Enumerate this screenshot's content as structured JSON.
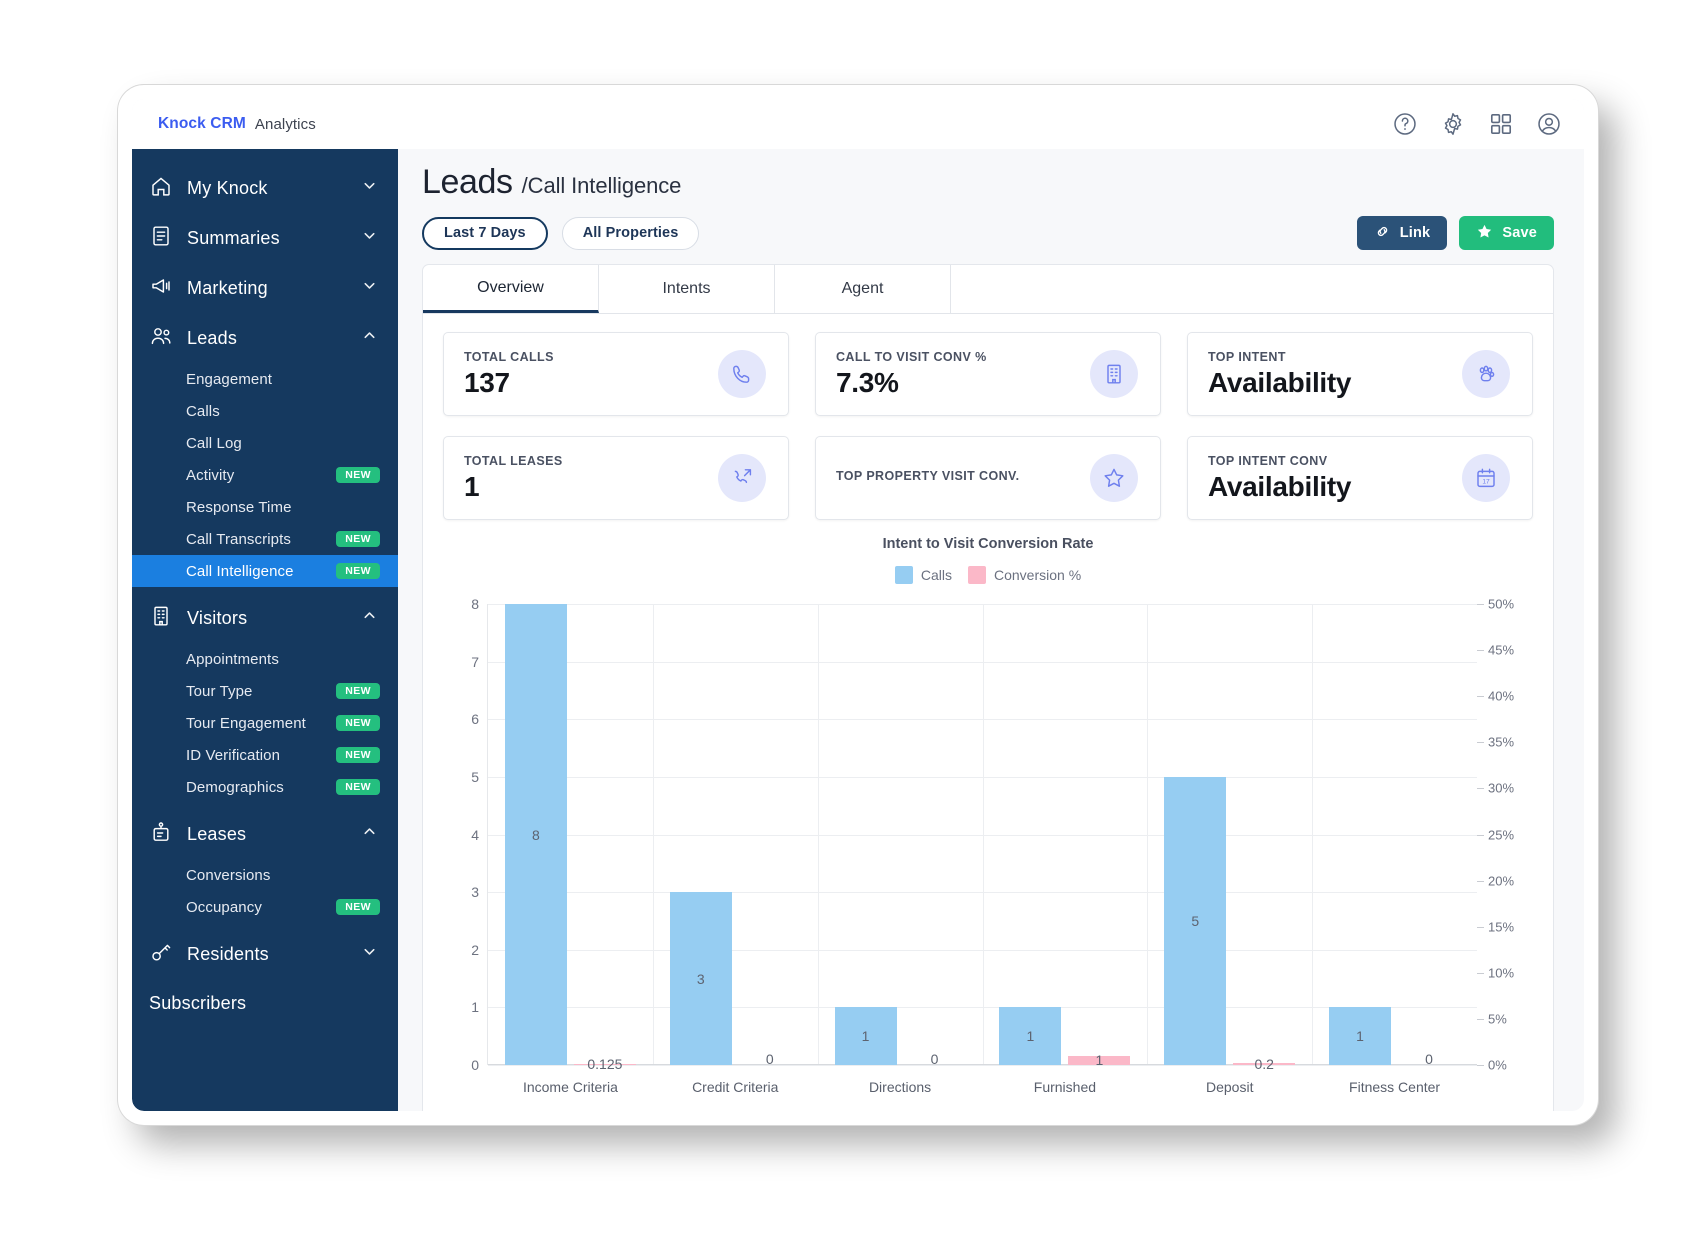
{
  "topbar": {
    "brand": "Knock CRM",
    "brand_sub": "Analytics",
    "icons": [
      "help-icon",
      "gear-icon",
      "grid-icon",
      "account-icon"
    ]
  },
  "sidebar": {
    "groups": [
      {
        "label": "My Knock",
        "icon": "home-icon",
        "expanded": false,
        "items": []
      },
      {
        "label": "Summaries",
        "icon": "document-icon",
        "expanded": false,
        "items": []
      },
      {
        "label": "Marketing",
        "icon": "megaphone-icon",
        "expanded": false,
        "items": []
      },
      {
        "label": "Leads",
        "icon": "people-icon",
        "expanded": true,
        "items": [
          {
            "label": "Engagement",
            "badge": "",
            "active": false
          },
          {
            "label": "Calls",
            "badge": "",
            "active": false
          },
          {
            "label": "Call Log",
            "badge": "",
            "active": false
          },
          {
            "label": "Activity",
            "badge": "NEW",
            "active": false
          },
          {
            "label": "Response Time",
            "badge": "",
            "active": false
          },
          {
            "label": "Call Transcripts",
            "badge": "NEW",
            "active": false
          },
          {
            "label": "Call Intelligence",
            "badge": "NEW",
            "active": true
          }
        ]
      },
      {
        "label": "Visitors",
        "icon": "building-icon",
        "expanded": true,
        "items": [
          {
            "label": "Appointments",
            "badge": "",
            "active": false
          },
          {
            "label": "Tour Type",
            "badge": "NEW",
            "active": false
          },
          {
            "label": "Tour Engagement",
            "badge": "NEW",
            "active": false
          },
          {
            "label": "ID Verification",
            "badge": "NEW",
            "active": false
          },
          {
            "label": "Demographics",
            "badge": "NEW",
            "active": false
          }
        ]
      },
      {
        "label": "Leases",
        "icon": "lease-icon",
        "expanded": true,
        "items": [
          {
            "label": "Conversions",
            "badge": "",
            "active": false
          },
          {
            "label": "Occupancy",
            "badge": "NEW",
            "active": false
          }
        ]
      },
      {
        "label": "Residents",
        "icon": "key-icon",
        "expanded": false,
        "items": []
      }
    ],
    "plain_item": "Subscribers"
  },
  "page": {
    "title": "Leads",
    "subtitle": "/Call Intelligence",
    "filters": [
      {
        "label": "Last 7 Days",
        "selected": true
      },
      {
        "label": "All Properties",
        "selected": false
      }
    ],
    "actions": [
      {
        "label": "Link",
        "icon": "link-icon",
        "style": "dark"
      },
      {
        "label": "Save",
        "icon": "star-icon",
        "style": "green"
      }
    ]
  },
  "tabs": [
    {
      "label": "Overview",
      "active": true
    },
    {
      "label": "Intents",
      "active": false
    },
    {
      "label": "Agent",
      "active": false
    }
  ],
  "kpis": [
    [
      {
        "label": "TOTAL CALLS",
        "value": "137",
        "icon": "phone-icon"
      },
      {
        "label": "CALL TO VISIT CONV %",
        "value": "7.3%",
        "icon": "building-icon"
      },
      {
        "label": "TOP INTENT",
        "value": "Availability",
        "icon": "paw-icon"
      }
    ],
    [
      {
        "label": "TOTAL LEASES",
        "value": "1",
        "icon": "arrow-call-icon"
      },
      {
        "label": "TOP PROPERTY VISIT CONV.",
        "value": "",
        "icon": "star-outline-icon"
      },
      {
        "label": "TOP INTENT CONV",
        "value": "Availability",
        "icon": "calendar-icon"
      }
    ]
  ],
  "chart_data": {
    "type": "bar",
    "title": "Intent to Visit Conversion Rate",
    "xlabel": "",
    "ylabel": "",
    "grid": true,
    "legend_position": "top-center",
    "categories": [
      "Income Criteria",
      "Credit Criteria",
      "Directions",
      "Furnished",
      "Deposit",
      "Fitness Center"
    ],
    "series": [
      {
        "name": "Calls",
        "axis": "left",
        "color": "#96cdf2",
        "values": [
          8,
          3,
          1,
          1,
          5,
          1
        ],
        "labels": [
          "8",
          "3",
          "1",
          "1",
          "5",
          "1"
        ]
      },
      {
        "name": "Conversion %",
        "axis": "right",
        "color": "#fbb8c8",
        "values": [
          0.125,
          0,
          0,
          1,
          0.2,
          0
        ],
        "labels": [
          "0.125",
          "0",
          "0",
          "1",
          "0.2",
          "0"
        ]
      }
    ],
    "ylim": [
      0,
      8
    ],
    "yticks": [
      "0",
      "1",
      "2",
      "3",
      "4",
      "5",
      "6",
      "7",
      "8"
    ],
    "y2lim": [
      0,
      50
    ],
    "y2ticks": [
      "0%",
      "5%",
      "10%",
      "15%",
      "20%",
      "25%",
      "30%",
      "35%",
      "40%",
      "45%",
      "50%"
    ]
  }
}
